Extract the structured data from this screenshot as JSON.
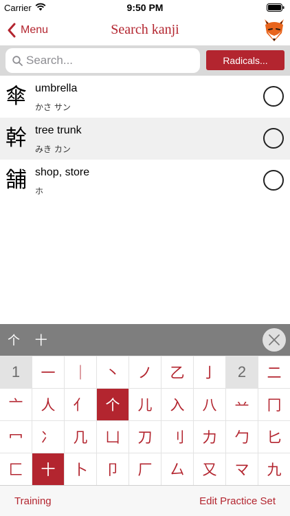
{
  "status_bar": {
    "carrier": "Carrier",
    "time": "9:50 PM"
  },
  "nav": {
    "back_label": "Menu",
    "title": "Search kanji",
    "logo_icon": "fox-logo-icon"
  },
  "search": {
    "placeholder": "Search...",
    "value": "",
    "radicals_button": "Radicals..."
  },
  "results": [
    {
      "kanji": "傘",
      "meaning": "umbrella",
      "reading": "かさ サン",
      "selected": false
    },
    {
      "kanji": "幹",
      "meaning": "tree trunk",
      "reading": "みき カン",
      "selected": false
    },
    {
      "kanji": "舗",
      "meaning": "shop, store",
      "reading": "ホ",
      "selected": false
    }
  ],
  "selected_radicals": "个 十",
  "radical_grid": [
    [
      "1",
      "一",
      "｜",
      "丶",
      "ノ",
      "乙",
      "亅",
      "2",
      "二"
    ],
    [
      "亠",
      "人",
      "亻",
      "个",
      "儿",
      "入",
      "八",
      "䒑",
      "冂"
    ],
    [
      "冖",
      "冫",
      "几",
      "凵",
      "刀",
      "刂",
      "力",
      "勹",
      "匕"
    ],
    [
      "匚",
      "十",
      "卜",
      "卩",
      "厂",
      "厶",
      "又",
      "マ",
      "九"
    ]
  ],
  "radical_stroke_headers": [
    "1",
    "2"
  ],
  "radical_selected": [
    "个",
    "十"
  ],
  "toolbar": {
    "training": "Training",
    "edit_practice_set": "Edit Practice Set"
  },
  "colors": {
    "accent": "#b3252f",
    "selected_bar": "#7e7e7e",
    "alt_row": "#f0f0f0"
  }
}
